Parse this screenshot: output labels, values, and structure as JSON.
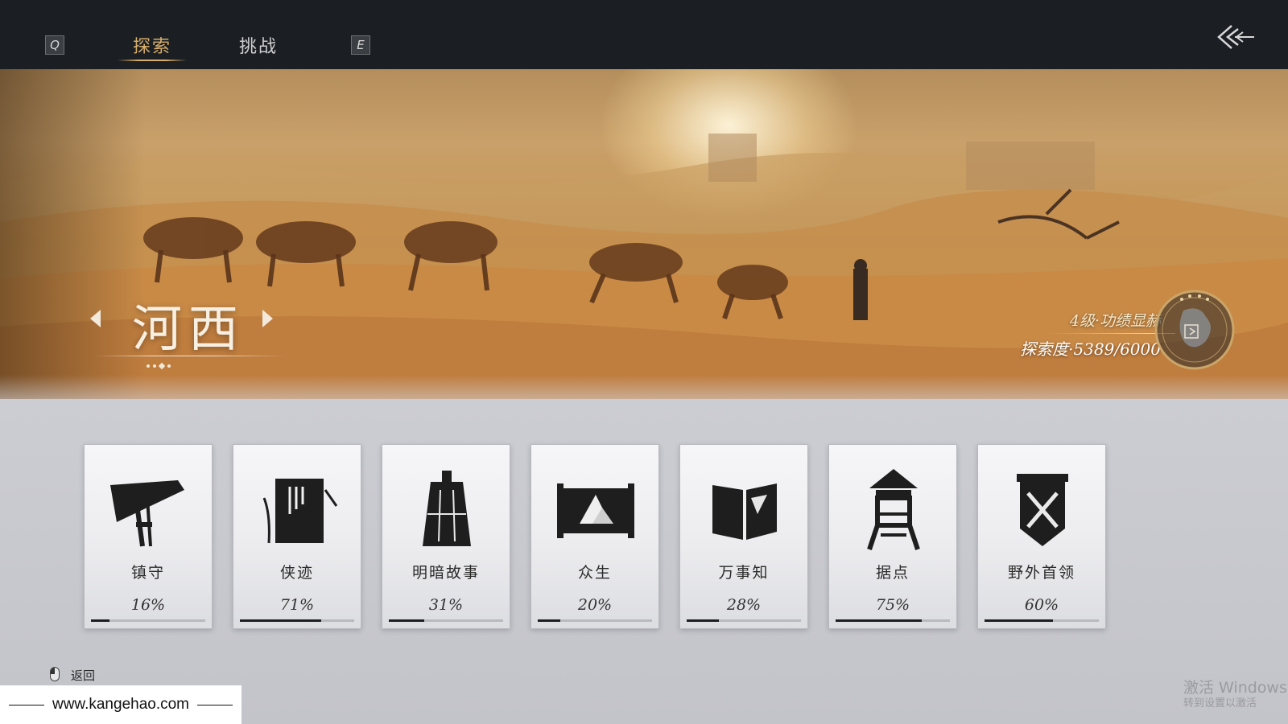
{
  "topbar": {
    "key_prev": "Q",
    "key_next": "E",
    "tabs": [
      {
        "label": "探索",
        "active": true
      },
      {
        "label": "挑战",
        "active": false
      }
    ],
    "back_icon": "triple-chevron-left-icon"
  },
  "banner": {
    "region_name": "河西",
    "level_text": "4级·功绩显赫",
    "progress_text": "探索度·5389/6000",
    "progress_value": 5389,
    "progress_max": 6000,
    "map_icon": "region-map-icon"
  },
  "cards": [
    {
      "label": "镇守",
      "pct": "16%",
      "value": 0.16,
      "icon": "straw-hat-icon"
    },
    {
      "label": "侠迹",
      "pct": "71%",
      "value": 0.71,
      "icon": "book-bamboo-icon"
    },
    {
      "label": "明暗故事",
      "pct": "31%",
      "value": 0.31,
      "icon": "bell-icon"
    },
    {
      "label": "众生",
      "pct": "20%",
      "value": 0.2,
      "icon": "scroll-painting-icon"
    },
    {
      "label": "万事知",
      "pct": "28%",
      "value": 0.28,
      "icon": "open-book-icon"
    },
    {
      "label": "据点",
      "pct": "75%",
      "value": 0.75,
      "icon": "watchtower-icon"
    },
    {
      "label": "野外首领",
      "pct": "60%",
      "value": 0.6,
      "icon": "crossed-swords-shield-icon"
    }
  ],
  "bottom": {
    "back_label": "返回",
    "watermark_url": "www.kangehao.com",
    "activate_text": "激活 Windows",
    "activate_sub": "转到设置以激活"
  },
  "colors": {
    "topbar_bg": "#1b1f24",
    "tab_active": "#d8ae6a",
    "bar_fill": "#1e1e1e"
  }
}
